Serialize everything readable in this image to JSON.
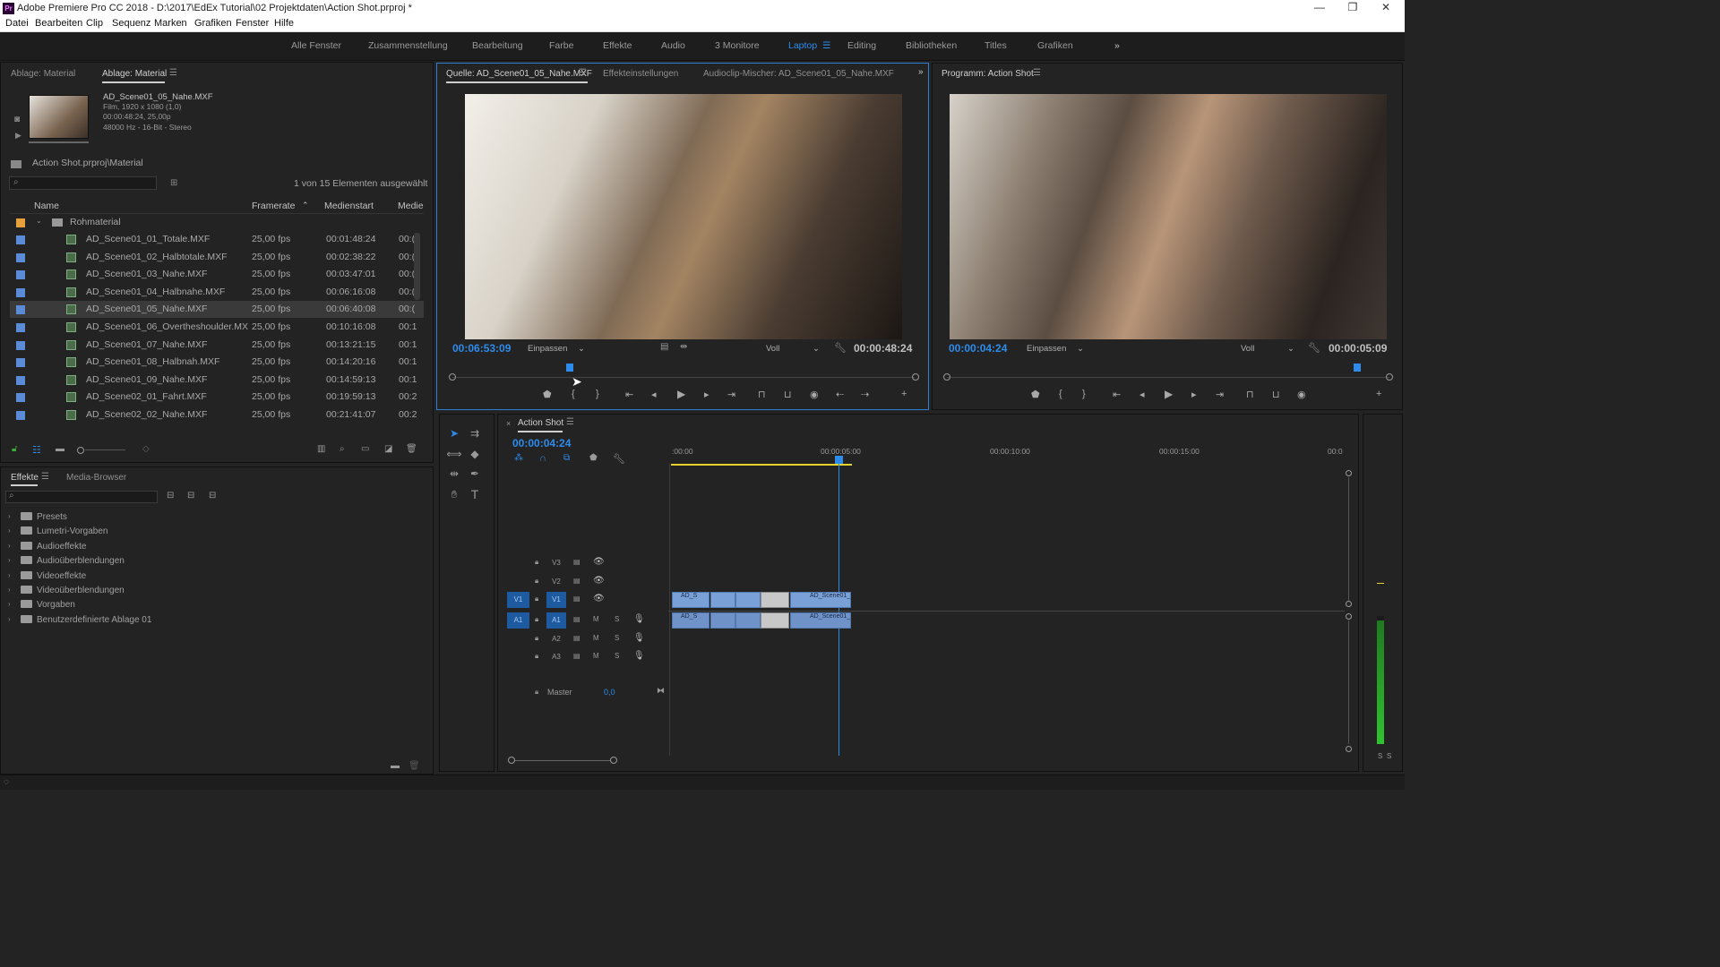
{
  "window": {
    "title": "Adobe Premiere Pro CC 2018 - D:\\2017\\EdEx Tutorial\\02 Projektdaten\\Action Shot.prproj *",
    "app_badge": "Pr"
  },
  "menu": [
    "Datei",
    "Bearbeiten",
    "Clip",
    "Sequenz",
    "Marken",
    "Grafiken",
    "Fenster",
    "Hilfe"
  ],
  "workspaces": {
    "items": [
      "Alle Fenster",
      "Zusammenstellung",
      "Bearbeitung",
      "Farbe",
      "Effekte",
      "Audio",
      "3 Monitore",
      "Laptop",
      "Editing",
      "Bibliotheken",
      "Titles",
      "Grafiken"
    ],
    "active": "Laptop",
    "more": "»"
  },
  "project": {
    "tabs": [
      "Ablage: Material",
      "Ablage: Material"
    ],
    "preview": {
      "name": "AD_Scene01_05_Nahe.MXF",
      "line1": "Film, 1920 x 1080 (1,0)",
      "line2": "00:00:48:24, 25,00p",
      "line3": "48000 Hz - 16-Bit - Stereo"
    },
    "path": "Action Shot.prproj\\Material",
    "selection_info": "1 von 15 Elementen ausgewählt",
    "columns": {
      "name": "Name",
      "framerate": "Framerate",
      "medienstart": "Medienstart",
      "medie": "Medie"
    },
    "folder": "Rohmaterial",
    "items": [
      {
        "name": "AD_Scene01_01_Totale.MXF",
        "fps": "25,00 fps",
        "start": "00:01:48:24",
        "m": "00:("
      },
      {
        "name": "AD_Scene01_02_Halbtotale.MXF",
        "fps": "25,00 fps",
        "start": "00:02:38:22",
        "m": "00:("
      },
      {
        "name": "AD_Scene01_03_Nahe.MXF",
        "fps": "25,00 fps",
        "start": "00:03:47:01",
        "m": "00:("
      },
      {
        "name": "AD_Scene01_04_Halbnahe.MXF",
        "fps": "25,00 fps",
        "start": "00:06:16:08",
        "m": "00:("
      },
      {
        "name": "AD_Scene01_05_Nahe.MXF",
        "fps": "25,00 fps",
        "start": "00:06:40:08",
        "m": "00:("
      },
      {
        "name": "AD_Scene01_06_Overtheshoulder.MX",
        "fps": "25,00 fps",
        "start": "00:10:16:08",
        "m": "00:1"
      },
      {
        "name": "AD_Scene01_07_Nahe.MXF",
        "fps": "25,00 fps",
        "start": "00:13:21:15",
        "m": "00:1"
      },
      {
        "name": "AD_Scene01_08_Halbnah.MXF",
        "fps": "25,00 fps",
        "start": "00:14:20:16",
        "m": "00:1"
      },
      {
        "name": "AD_Scene01_09_Nahe.MXF",
        "fps": "25,00 fps",
        "start": "00:14:59:13",
        "m": "00:1"
      },
      {
        "name": "AD_Scene02_01_Fahrt.MXF",
        "fps": "25,00 fps",
        "start": "00:19:59:13",
        "m": "00:2"
      },
      {
        "name": "AD_Scene02_02_Nahe.MXF",
        "fps": "25,00 fps",
        "start": "00:21:41:07",
        "m": "00:2"
      }
    ]
  },
  "effects": {
    "tabs": [
      "Effekte",
      "Media-Browser"
    ],
    "items": [
      "Presets",
      "Lumetri-Vorgaben",
      "Audioeffekte",
      "Audioüberblendungen",
      "Videoeffekte",
      "Videoüberblendungen",
      "Vorgaben",
      "Benutzerdefinierte Ablage 01"
    ]
  },
  "source": {
    "tabs": [
      "Quelle: AD_Scene01_05_Nahe.MXF",
      "Effekteinstellungen",
      "Audioclip-Mischer: AD_Scene01_05_Nahe.MXF"
    ],
    "timecode": "00:06:53:09",
    "fit": "Einpassen",
    "quality": "Voll",
    "duration": "00:00:48:24"
  },
  "program": {
    "tab": "Programm: Action Shot",
    "timecode": "00:00:04:24",
    "fit": "Einpassen",
    "quality": "Voll",
    "duration": "00:00:05:09"
  },
  "timeline": {
    "tab": "Action Shot",
    "timecode": "00:00:04:24",
    "ruler": [
      ":00:00",
      "00:00:05:00",
      "00:00:10:00",
      "00:00:15:00",
      "00:0"
    ],
    "tracks": [
      {
        "patch": "",
        "name": "V3",
        "type": "video"
      },
      {
        "patch": "",
        "name": "V2",
        "type": "video"
      },
      {
        "patch": "V1",
        "name": "V1",
        "type": "video"
      },
      {
        "patch": "A1",
        "name": "A1",
        "type": "audio"
      },
      {
        "patch": "",
        "name": "A2",
        "type": "audio"
      },
      {
        "patch": "",
        "name": "A3",
        "type": "audio"
      }
    ],
    "master": {
      "label": "Master",
      "value": "0,0"
    },
    "clips": {
      "v1_first": "AD_S",
      "v1_last": "AD_Scene01_",
      "a1_first": "AD_S",
      "a1_last": "AD_Scene01_"
    },
    "mute": "M",
    "solo": "S"
  },
  "meter": {
    "labels": [
      "S",
      "S"
    ]
  },
  "colors": {
    "accent": "#2d8ceb",
    "yellow_bar": "#e8d32a"
  }
}
